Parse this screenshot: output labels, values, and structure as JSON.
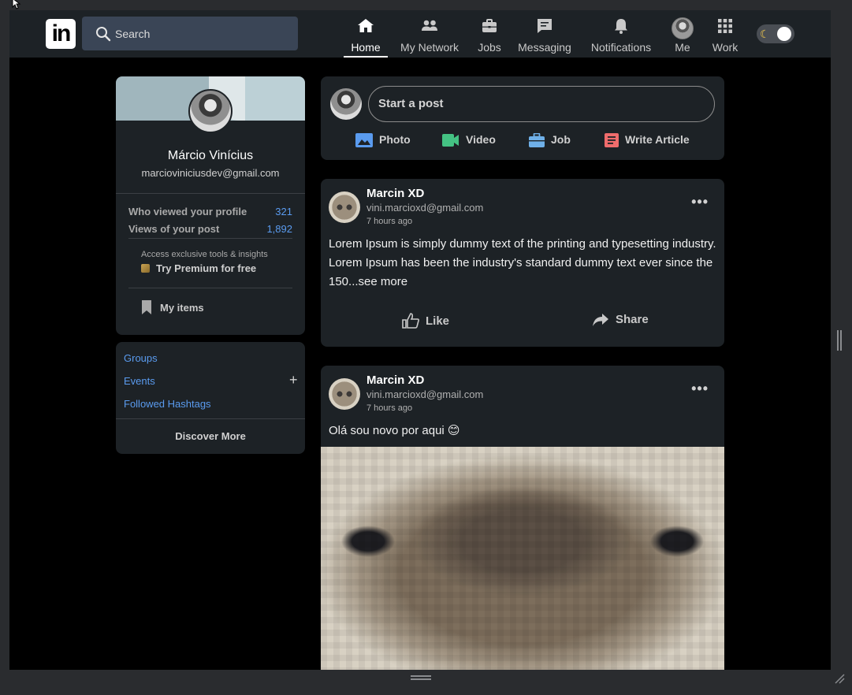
{
  "header": {
    "logo_text": "in",
    "search": {
      "placeholder": "Search"
    },
    "nav": [
      {
        "label": "Home",
        "icon": "home-icon",
        "active": true
      },
      {
        "label": "My Network",
        "icon": "network-icon"
      },
      {
        "label": "Jobs",
        "icon": "briefcase-icon"
      },
      {
        "label": "Messaging",
        "icon": "message-icon"
      },
      {
        "label": "Notifications",
        "icon": "bell-icon"
      },
      {
        "label": "Me",
        "icon": "avatar"
      },
      {
        "label": "Work",
        "icon": "grid-icon"
      }
    ],
    "theme_toggle": {
      "icon": "moon-icon",
      "moon_glyph": "☾",
      "state": "dark"
    }
  },
  "profile": {
    "name": "Márcio Vinícius",
    "email": "marcioviniciusdev@gmail.com",
    "stats": [
      {
        "label": "Who viewed your profile",
        "value": "321"
      },
      {
        "label": "Views of your post",
        "value": "1,892"
      }
    ],
    "premium_note": "Access exclusive tools & insights",
    "premium_link": "Try Premium for free",
    "my_items": "My items"
  },
  "side_links": {
    "groups": "Groups",
    "events": "Events",
    "plus": "+",
    "hashtags": "Followed Hashtags",
    "discover": "Discover More"
  },
  "composer": {
    "placeholder": "Start a post",
    "actions": [
      {
        "label": "Photo",
        "icon": "photo-icon",
        "color": "#5a9bef"
      },
      {
        "label": "Video",
        "icon": "video-icon",
        "color": "#44c283"
      },
      {
        "label": "Job",
        "icon": "briefcase-icon",
        "color": "#6fb0e8"
      },
      {
        "label": "Write Article",
        "icon": "article-icon",
        "color": "#ef6c6c"
      }
    ]
  },
  "posts": [
    {
      "author": "Marcin XD",
      "email": "vini.marcioxd@gmail.com",
      "time": "7 hours ago",
      "text": "Lorem Ipsum is simply dummy text of the printing and typesetting industry. Lorem Ipsum has been the industry's standard dummy text ever since the 150...see more",
      "like": "Like",
      "share": "Share"
    },
    {
      "author": "Marcin XD",
      "email": "vini.marcioxd@gmail.com",
      "time": "7 hours ago",
      "text": "Olá sou novo por aqui 😊"
    }
  ],
  "colors": {
    "page_bg": "#000000",
    "card_bg": "#1d2226",
    "header_bg": "#1d2226",
    "link_blue": "#5a9bef",
    "search_bg": "#3a4556"
  }
}
